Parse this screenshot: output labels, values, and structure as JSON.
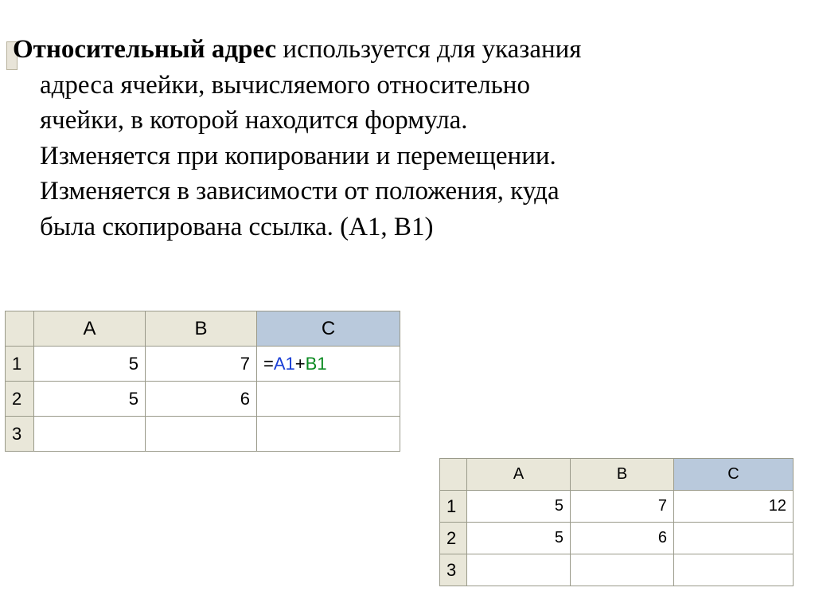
{
  "text": {
    "heading_bold": "Относительный адрес",
    "heading_rest": " используется для указания",
    "l2": "адреса ячейки, вычисляемого относительно",
    "l3": "ячейки, в которой находится формула.",
    "l4": "Изменяется при копировании и перемещении.",
    "l5": "Изменяется в зависимости от положения, куда",
    "l6": "была скопирована ссылка. (A1, B1)"
  },
  "sheet1": {
    "cols": [
      "A",
      "B",
      "C"
    ],
    "rows": [
      "1",
      "2",
      "3"
    ],
    "data": {
      "r1": {
        "A": "5",
        "B": "7"
      },
      "r2": {
        "A": "5",
        "B": "6"
      }
    },
    "formula": {
      "eq": "=",
      "ref1": "A1",
      "plus": "+",
      "ref2": "B1"
    }
  },
  "sheet2": {
    "cols": [
      "A",
      "B",
      "C"
    ],
    "rows": [
      "1",
      "2",
      "3"
    ],
    "data": {
      "r1": {
        "A": "5",
        "B": "7",
        "C": "12"
      },
      "r2": {
        "A": "5",
        "B": "6"
      }
    }
  }
}
